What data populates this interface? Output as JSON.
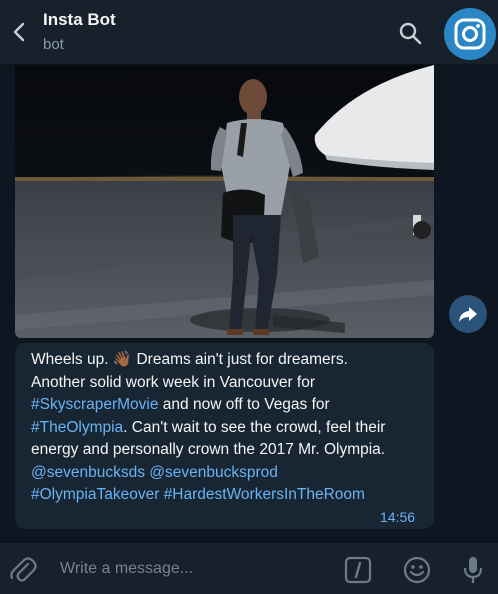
{
  "header": {
    "title": "Insta Bot",
    "subtitle": "bot",
    "avatar_icon": "instagram-icon",
    "accent": "#2b86c5"
  },
  "message": {
    "photo_alt": "photo",
    "lines": [
      {
        "segments": [
          {
            "text": "Wheels up. ",
            "link": false
          },
          {
            "text": "👋🏾",
            "link": false
          },
          {
            "text": " Dreams ain't just for dreamers.",
            "link": false
          }
        ]
      },
      {
        "segments": [
          {
            "text": "Another solid work week in Vancouver for",
            "link": false
          }
        ]
      },
      {
        "segments": [
          {
            "text": "#SkyscraperMovie",
            "link": true
          },
          {
            "text": " and now off to Vegas for",
            "link": false
          }
        ]
      },
      {
        "segments": [
          {
            "text": "#TheOlympia",
            "link": true
          },
          {
            "text": ". Can't wait to see the crowd, feel their",
            "link": false
          }
        ]
      },
      {
        "segments": [
          {
            "text": "energy and personally crown the 2017 Mr. Olympia.",
            "link": false
          }
        ]
      },
      {
        "segments": [
          {
            "text": "@sevenbucksds",
            "link": true
          },
          {
            "text": " ",
            "link": false
          },
          {
            "text": "@sevenbucksprod",
            "link": true
          }
        ]
      },
      {
        "segments": [
          {
            "text": "#OlympiaTakeover",
            "link": true
          },
          {
            "text": " ",
            "link": false
          },
          {
            "text": "#HardestWorkersInTheRoom",
            "link": true
          }
        ]
      }
    ],
    "time": "14:56",
    "link_color": "#6ab3f3"
  },
  "composer": {
    "placeholder": "Write a message...",
    "value": ""
  },
  "icons": {
    "back": "back-arrow-icon",
    "search": "search-icon",
    "forward": "forward-arrow-icon",
    "attach": "paperclip-icon",
    "commands": "slash-command-icon",
    "emoji": "smiley-icon",
    "mic": "microphone-icon"
  }
}
